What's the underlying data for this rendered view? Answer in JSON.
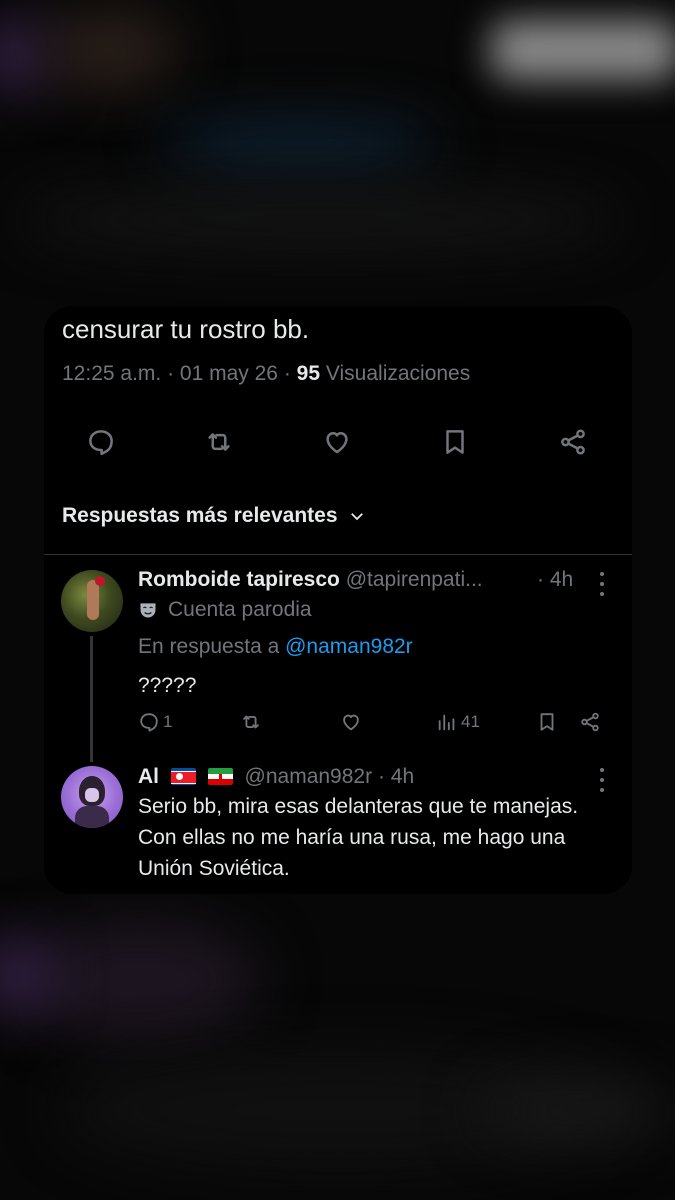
{
  "tweet": {
    "text": "censurar tu rostro bb.",
    "time": "12:25 a.m.",
    "date": "01 may 26",
    "views_count": "95",
    "views_label": "Visualizaciones",
    "separator": "·"
  },
  "actions": {
    "icons": [
      "reply-icon",
      "retweet-icon",
      "like-icon",
      "bookmark-icon",
      "share-icon"
    ]
  },
  "replies_sort": {
    "label": "Respuestas más relevantes"
  },
  "replies": [
    {
      "name": "Romboide tapiresco",
      "handle": "@tapirenpati...",
      "time": "· 4h",
      "badge": "Cuenta parodia",
      "in_reply_prefix": "En respuesta a",
      "in_reply_handle": "@naman982r",
      "text": "?????",
      "reply_count": "1",
      "views_count": "41"
    },
    {
      "name": "Al",
      "handle": "@naman982r",
      "time": "· 4h",
      "flags": [
        "north-korea-flag",
        "iran-flag"
      ],
      "text": "Serio bb, mira esas delanteras que te manejas. Con ellas no me haría una rusa, me hago una Unión Soviética."
    }
  ],
  "colors": {
    "background": "#000000",
    "text": "#e7e9ea",
    "secondary": "#71767b",
    "link": "#1d9bf0",
    "divider": "#2f3336"
  }
}
